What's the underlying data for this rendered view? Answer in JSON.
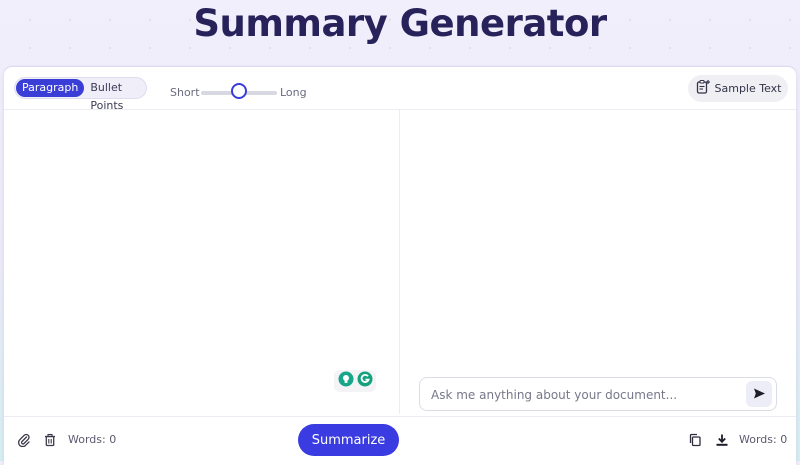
{
  "header": {
    "title": "Summary Generator"
  },
  "toolbar": {
    "modes": [
      {
        "label": "Paragraph",
        "active": true
      },
      {
        "label": "Bullet Points",
        "active": false
      }
    ],
    "length": {
      "min_label": "Short",
      "max_label": "Long",
      "value_fraction": 0.5
    },
    "sample_text_label": "Sample Text",
    "sample_icon": "clipboard-plus-icon"
  },
  "input": {
    "word_count": "Words: 0",
    "icons": [
      "paperclip-icon",
      "trash-icon"
    ]
  },
  "extensions": {
    "icons": [
      "lightbulb-icon",
      "grammarly-icon"
    ]
  },
  "chat": {
    "placeholder": "Ask me anything about your document...",
    "send_icon": "send-icon"
  },
  "actions": {
    "summarize_label": "Summarize"
  },
  "output": {
    "word_count": "Words: 0",
    "icons": [
      "copy-icon",
      "download-icon"
    ]
  },
  "colors": {
    "accent": "#3a3be0",
    "title": "#28225a"
  }
}
